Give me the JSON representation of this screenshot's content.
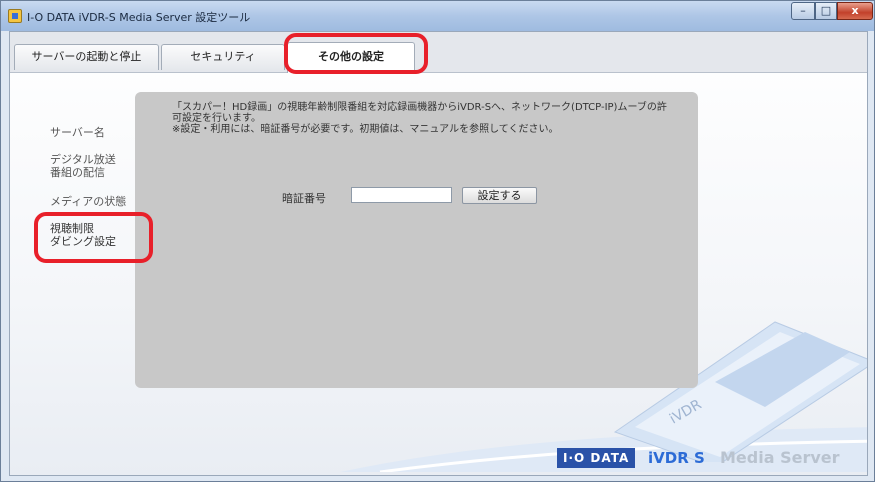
{
  "window": {
    "title": "I-O DATA iVDR-S Media Server 設定ツール",
    "controls": [
      "–",
      "□",
      "x"
    ]
  },
  "tabs": [
    {
      "label": "サーバーの起動と停止",
      "active": false
    },
    {
      "label": "セキュリティ",
      "active": false
    },
    {
      "label": "その他の設定",
      "active": true
    }
  ],
  "sidebar": {
    "items": [
      {
        "label": "サーバー名"
      },
      {
        "label": "デジタル放送\n番組の配信"
      },
      {
        "label": "メディアの状態"
      },
      {
        "label": "視聴制限\nダビング設定",
        "selected": true
      }
    ]
  },
  "content": {
    "description": "「スカパー！HD録画」の視聴年齢制限番組を対応録画機器からiVDR-Sへ、ネットワーク(DTCP-IP)ムーブの許\n可設定を行います。\n※設定・利用には、暗証番号が必要です。初期値は、マニュアルを参照してください。",
    "pin_label": "暗証番号",
    "pin_value": "",
    "set_button": "設定する"
  },
  "footer": {
    "iodata_logo": "I·O DATA",
    "ivdr_logo": "iVDR S",
    "product_text": "Media Server"
  },
  "colors": {
    "highlight": "#e8202a",
    "panel": "#c8c8c8",
    "brand_blue": "#2a52a8"
  }
}
